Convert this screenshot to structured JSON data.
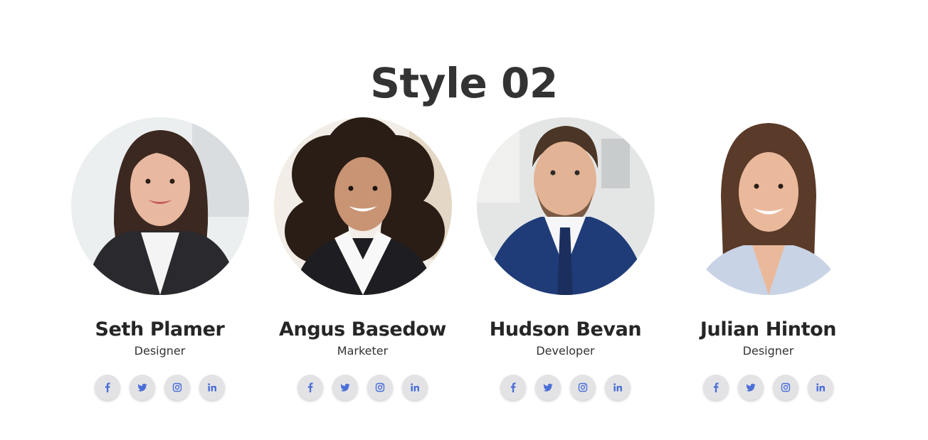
{
  "page": {
    "title": "Style 02"
  },
  "colors": {
    "accent": "#4b6fd6",
    "social_bg": "#e3e3e6",
    "text": "#262626"
  },
  "team": [
    {
      "name": "Seth Plamer",
      "role": "Designer",
      "photo": {
        "bg": "#eceff0",
        "hair": "#3b2820",
        "skin": "#e8b8a0",
        "outfit": "#2a2a2e",
        "shirt": "#f4f4f4"
      },
      "social": [
        "facebook-icon",
        "twitter-icon",
        "instagram-icon",
        "linkedin-icon"
      ]
    },
    {
      "name": "Angus Basedow",
      "role": "Marketer",
      "photo": {
        "bg": "#f2ede6",
        "hair": "#2a1d15",
        "skin": "#c99474",
        "outfit": "#1e1e22",
        "shirt": "#f8f8f8"
      },
      "social": [
        "facebook-icon",
        "twitter-icon",
        "instagram-icon",
        "linkedin-icon"
      ]
    },
    {
      "name": "Hudson Bevan",
      "role": "Developer",
      "photo": {
        "bg": "#e4e6e6",
        "hair": "#4a3526",
        "skin": "#e2b394",
        "outfit": "#1f3c78",
        "shirt": "#f6f6f8"
      },
      "social": [
        "facebook-icon",
        "twitter-icon",
        "instagram-icon",
        "linkedin-icon"
      ]
    },
    {
      "name": "Julian Hinton",
      "role": "Designer",
      "photo": {
        "bg": "#ffffff",
        "hair": "#5a3a28",
        "skin": "#eab99c",
        "outfit": "#c9d3e6",
        "shirt": "#e9eef6"
      },
      "social": [
        "facebook-icon",
        "twitter-icon",
        "instagram-icon",
        "linkedin-icon"
      ]
    }
  ]
}
